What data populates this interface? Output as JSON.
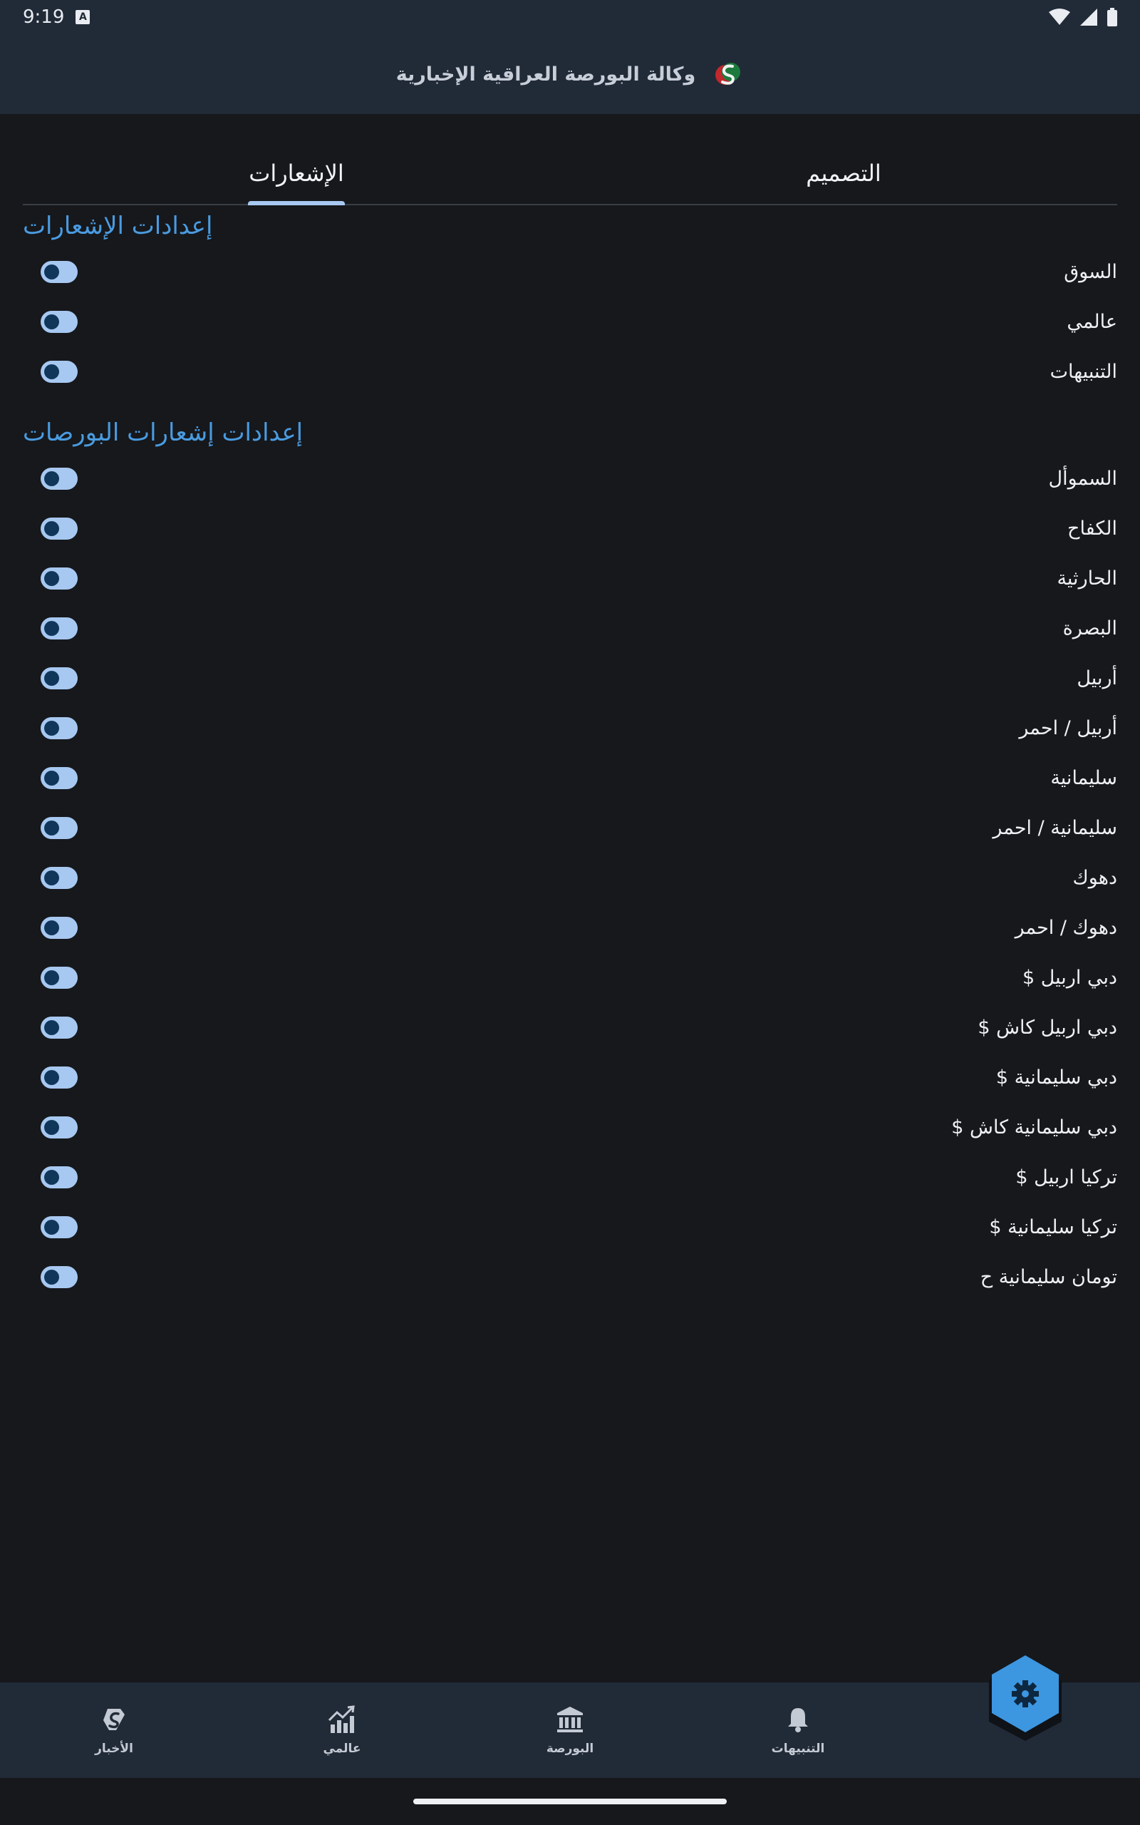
{
  "status_bar": {
    "time": "9:19",
    "icons": [
      "accessibility-icon",
      "wifi-icon",
      "signal-icon",
      "battery-icon"
    ]
  },
  "header": {
    "title": "وكالة البورصة العراقية الإخبارية",
    "logo_icon": "app-logo-icon"
  },
  "tabs": [
    {
      "label": "الإشعارات",
      "active": true
    },
    {
      "label": "التصميم",
      "active": false
    }
  ],
  "sections": {
    "notifications": {
      "title": "إعدادات الإشعارات",
      "items": [
        "السوق",
        "عالمي",
        "التنبيهات"
      ]
    },
    "exchanges": {
      "title": "إعدادات إشعارات البورصات",
      "items": [
        "السموأل",
        "الكفاح",
        "الحارثية",
        "البصرة",
        "أربيل",
        "أربيل / احمر",
        "سليمانية",
        "سليمانية / احمر",
        "دهوك",
        "دهوك / احمر",
        "دبي اربيل $",
        "دبي اربيل كاش $",
        "دبي سليمانية $",
        "دبي سليمانية كاش $",
        "تركيا اربيل $",
        "تركيا سليمانية $",
        "تومان سليمانية ح"
      ]
    }
  },
  "toggle_state": "off",
  "bottom_nav": [
    {
      "label": "الأخبار",
      "icon": "news-logo-icon"
    },
    {
      "label": "عالمي",
      "icon": "chart-up-icon"
    },
    {
      "label": "البورصة",
      "icon": "bank-icon"
    },
    {
      "label": "التنبيهات",
      "icon": "bell-icon"
    }
  ],
  "fab": {
    "icon": "settings-gear-icon"
  },
  "colors": {
    "background": "#16181c",
    "bar": "#212a37",
    "accent": "#4a9be0",
    "toggle_track": "#a7c8f1",
    "toggle_knob": "#10375a",
    "fab": "#3d96e0"
  }
}
